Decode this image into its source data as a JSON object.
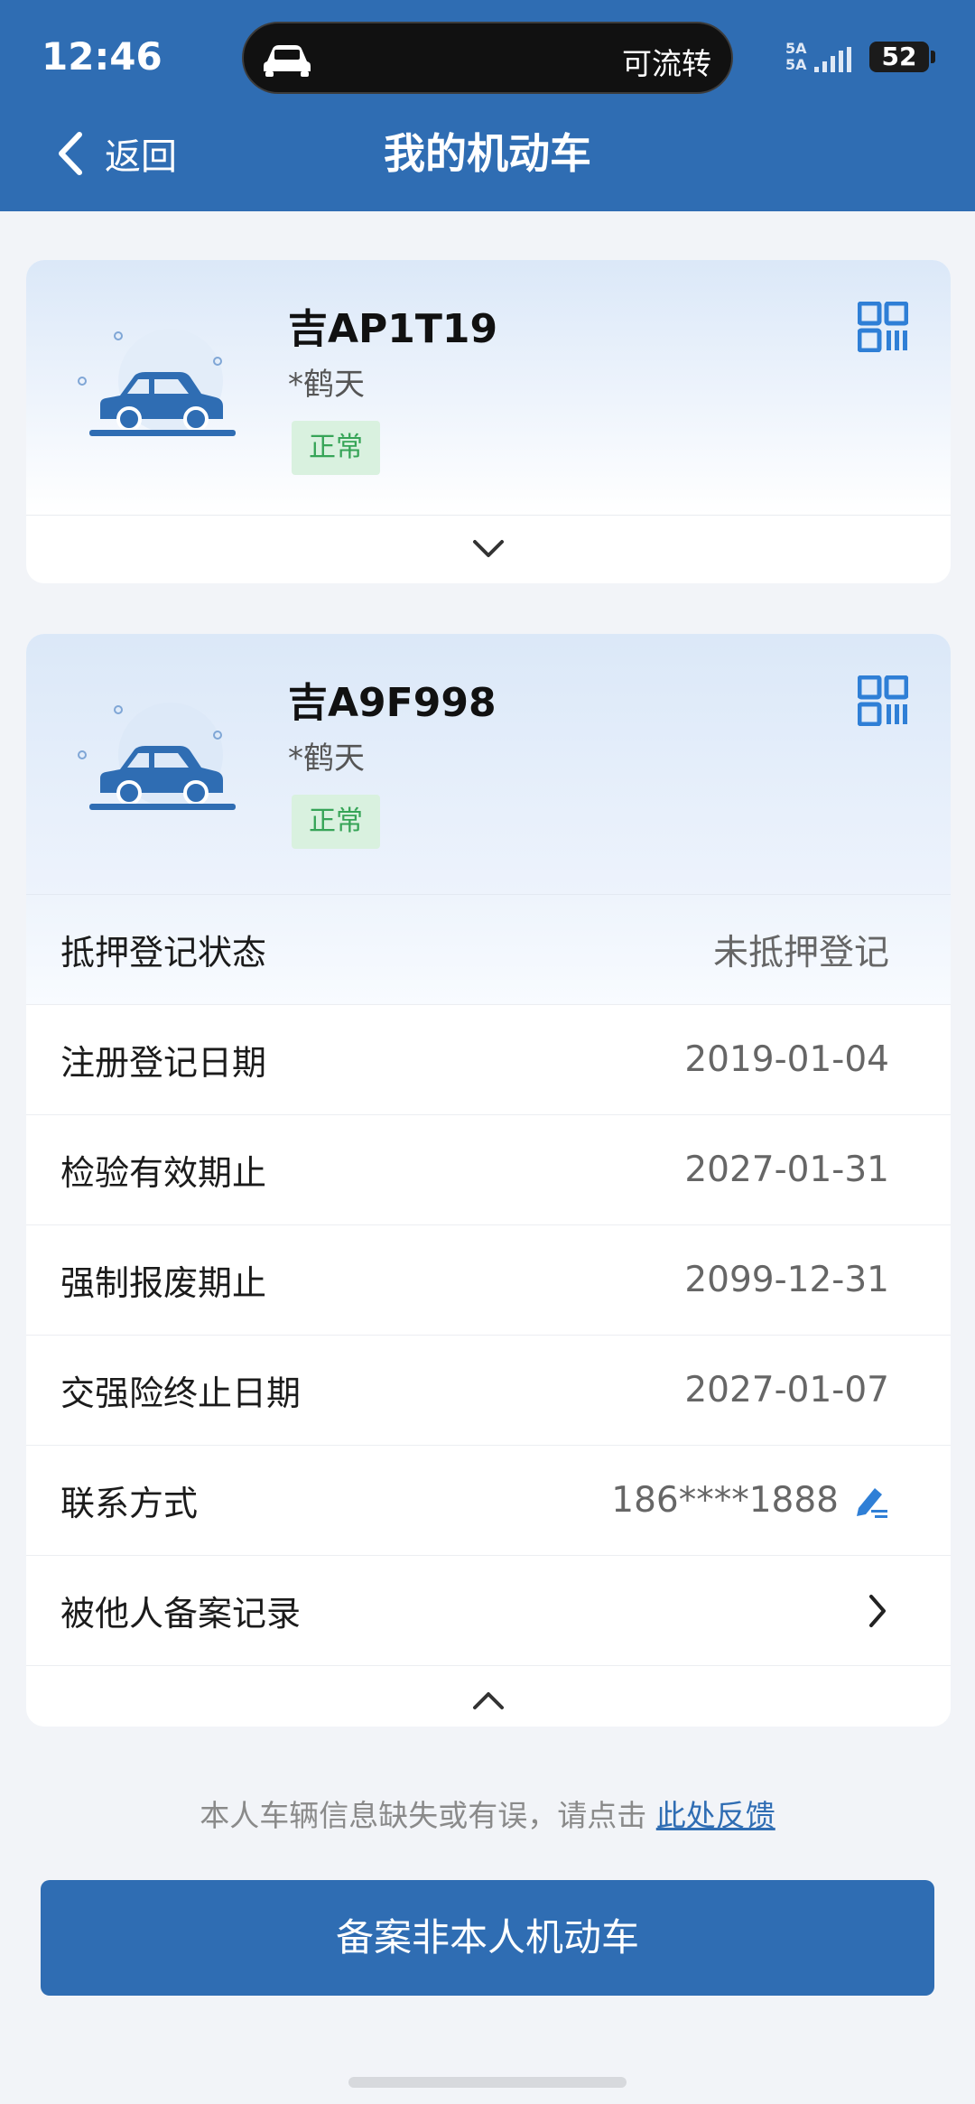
{
  "status_bar": {
    "time": "12:46",
    "island_text": "可流转",
    "signal_label_1": "5A",
    "signal_label_2": "5A",
    "battery": "52"
  },
  "nav": {
    "back_label": "返回",
    "title": "我的机动车"
  },
  "vehicles": [
    {
      "plate": "吉AP1T19",
      "owner": "*鹤天",
      "status": "正常"
    },
    {
      "plate": "吉A9F998",
      "owner": "*鹤天",
      "status": "正常"
    }
  ],
  "details": {
    "rows": [
      {
        "label": "抵押登记状态",
        "value": "未抵押登记"
      },
      {
        "label": "注册登记日期",
        "value": "2019-01-04"
      },
      {
        "label": "检验有效期止",
        "value": "2027-01-31"
      },
      {
        "label": "强制报废期止",
        "value": "2099-12-31"
      },
      {
        "label": "交强险终止日期",
        "value": "2027-01-07"
      },
      {
        "label": "联系方式",
        "value": "186****1888"
      },
      {
        "label": "被他人备案记录",
        "value": ""
      }
    ]
  },
  "feedback": {
    "text": "本人车辆信息缺失或有误，请点击",
    "link": "此处反馈"
  },
  "primary_button": "备案非本人机动车",
  "colors": {
    "brand": "#2f6db3",
    "status_green": "#36a457",
    "badge_bg": "#d9f1df"
  }
}
